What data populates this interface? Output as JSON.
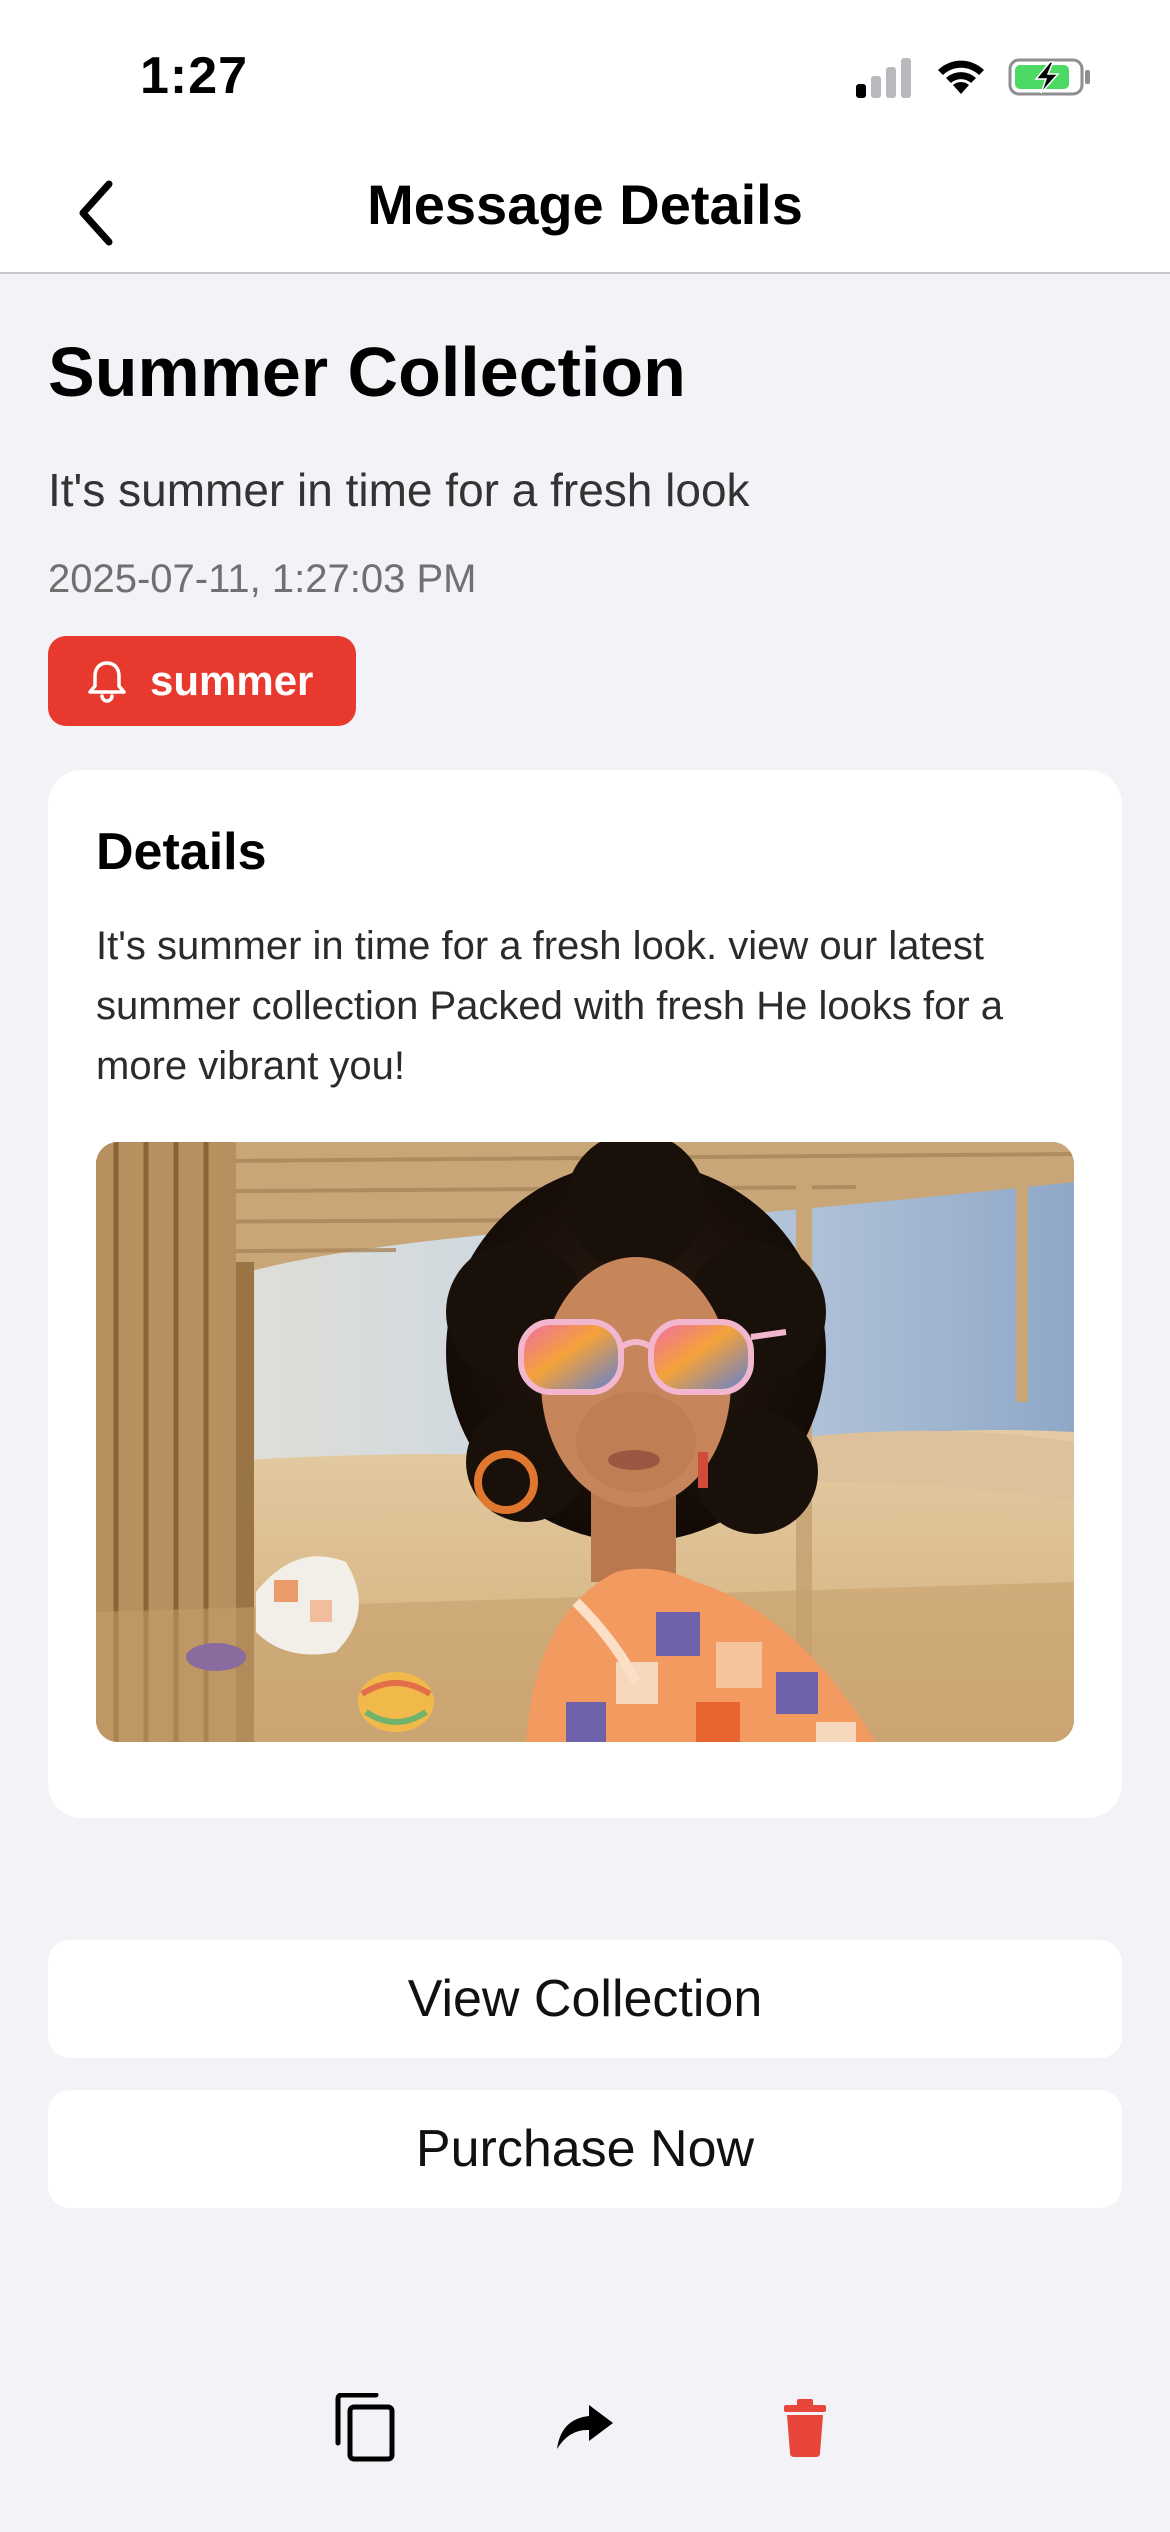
{
  "status_bar": {
    "time": "1:27"
  },
  "nav": {
    "title": "Message Details",
    "back_icon": "chevron-left-icon"
  },
  "message": {
    "title": "Summer Collection",
    "subtitle": "It's summer in time for a fresh look",
    "timestamp": "2025-07-11, 1:27:03 PM",
    "tag": {
      "label": "summer",
      "icon": "bell-icon",
      "color": "#e8392e"
    }
  },
  "details": {
    "heading": "Details",
    "body": "It's summer in time for a fresh look. view our latest summer collection Packed with fresh He looks for a more vibrant you!"
  },
  "actions": {
    "view_label": "View Collection",
    "purchase_label": "Purchase Now"
  },
  "toolbar": {
    "copy_icon": "copy-icon",
    "share_icon": "share-arrow-icon",
    "delete_icon": "trash-icon",
    "delete_color": "#e8463b"
  },
  "colors": {
    "background": "#f2f2f7",
    "accent": "#e8392e",
    "battery_fill": "#4cd964"
  }
}
